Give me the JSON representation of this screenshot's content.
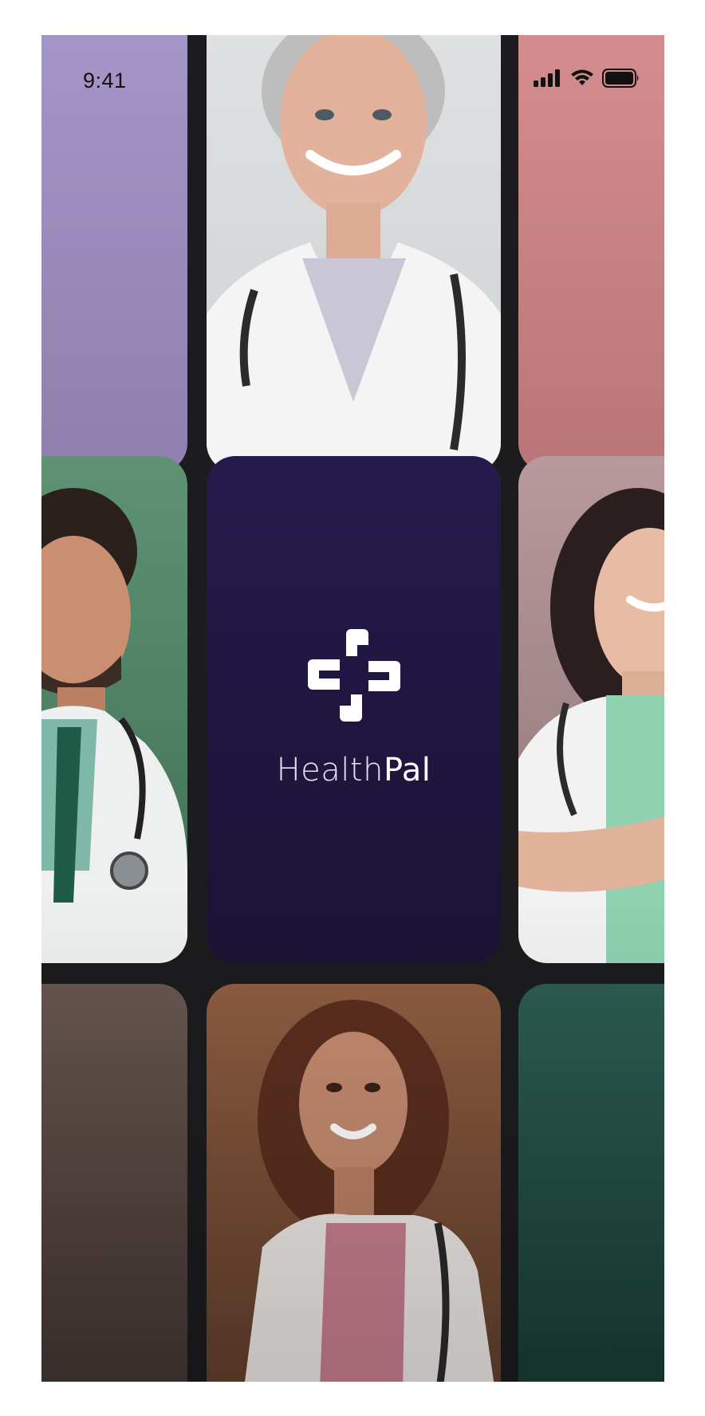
{
  "status_bar": {
    "time": "9:41",
    "icons": [
      "signal-icon",
      "wifi-icon",
      "battery-icon"
    ]
  },
  "brand": {
    "name_light": "Health",
    "name_bold": "Pal",
    "logo": "healthpal-cross-logo",
    "background": "#241848"
  },
  "tiles": [
    {
      "name": "tile-purple",
      "color": "#a697c9"
    },
    {
      "name": "tile-doctor-older-woman",
      "color": "#dfe1e2"
    },
    {
      "name": "tile-pink",
      "color": "#d68f90"
    },
    {
      "name": "tile-doctor-man",
      "color": "#5f9274"
    },
    {
      "name": "tile-logo",
      "color": "#241848"
    },
    {
      "name": "tile-doctor-woman-pink",
      "color": "#b8999c"
    },
    {
      "name": "tile-brown",
      "color": "#685650"
    },
    {
      "name": "tile-doctor-woman-orange",
      "color": "#8e5d41"
    },
    {
      "name": "tile-teal",
      "color": "#2c5c51"
    }
  ]
}
